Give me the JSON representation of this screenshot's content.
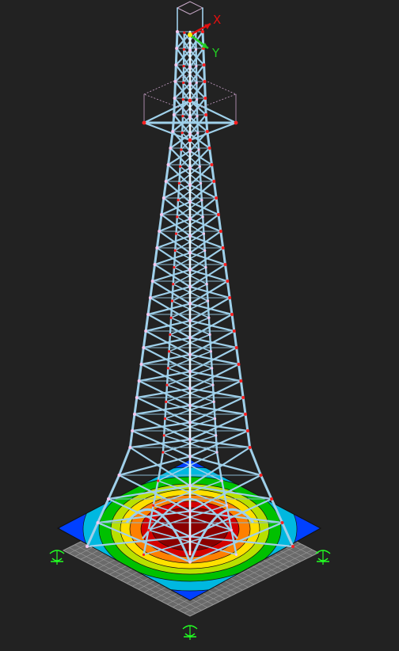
{
  "viewport": {
    "background": "#222222"
  },
  "axes": {
    "x_label": "X",
    "y_label": "Y",
    "x_color": "#e01010",
    "y_color": "#22cc22"
  },
  "tower": {
    "member_color": "#9fd0ea",
    "member_highlight": "#e8f6ff",
    "node_color": "#ff2020",
    "secondary_node_color": "#f4c8f0"
  },
  "foundation": {
    "contour_palette": [
      "#8b0000",
      "#d40000",
      "#ff8000",
      "#ffe000",
      "#b8e000",
      "#00c000",
      "#00b8e0",
      "#0040ff",
      "#2020c0"
    ],
    "grid_color": "#9a9a9a"
  },
  "supports": {
    "icon": "fixed-support-icon",
    "color": "#22ff22",
    "count": 4
  }
}
